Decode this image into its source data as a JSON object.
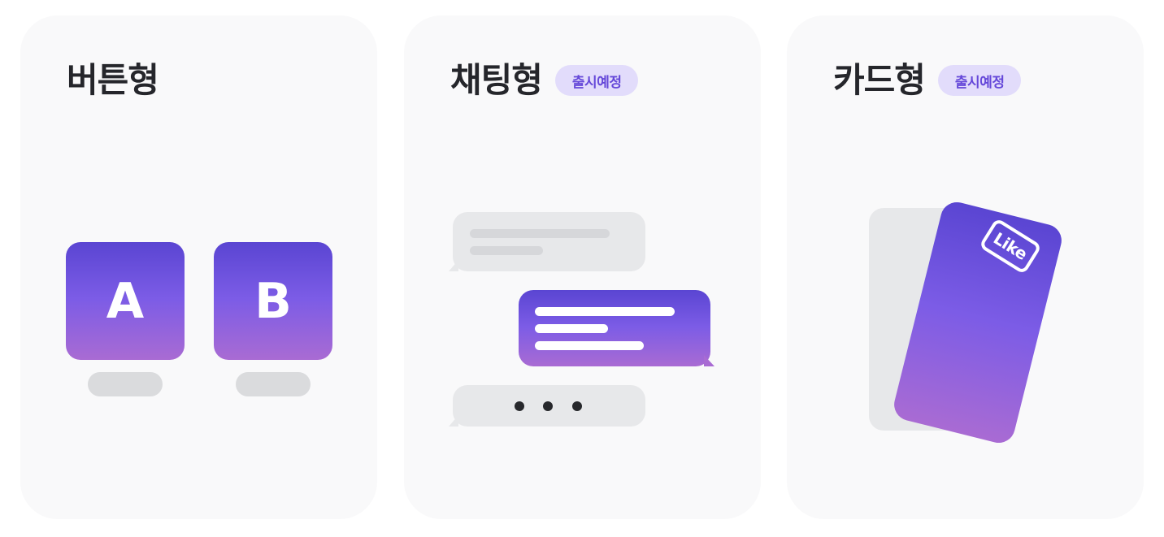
{
  "cards": {
    "button": {
      "title": "버튼형",
      "options": [
        "A",
        "B"
      ]
    },
    "chat": {
      "title": "채팅형",
      "badge": "출시예정"
    },
    "card": {
      "title": "카드형",
      "badge": "출시예정",
      "stamp": "Like"
    }
  },
  "colors": {
    "card_bg": "#f9f9fa",
    "title": "#25262b",
    "badge_bg": "#e2dcfb",
    "badge_text": "#6548d9",
    "gradient": [
      "#5a45d2",
      "#7c5ce6",
      "#a96bd3"
    ],
    "placeholder_gray": "#e7e8ea"
  }
}
